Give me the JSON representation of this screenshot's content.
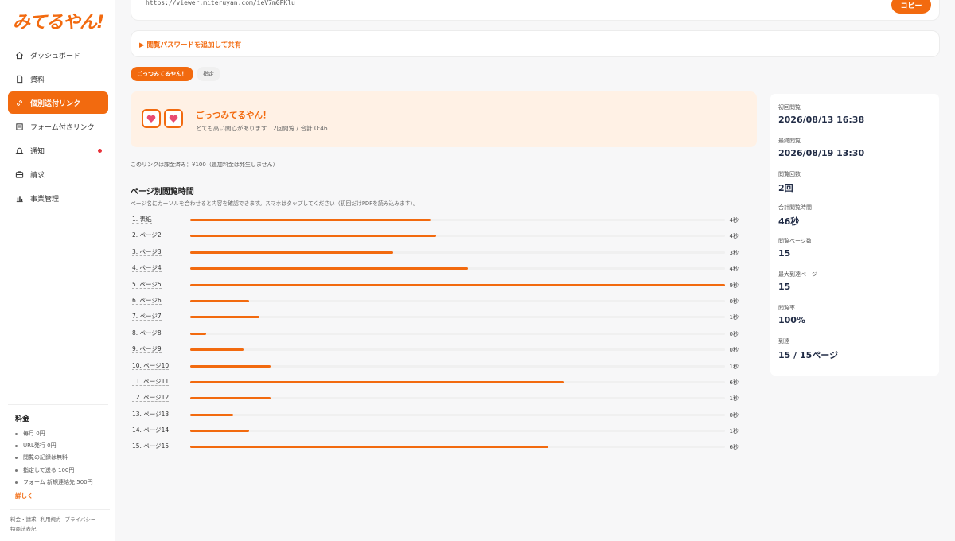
{
  "app": {
    "logo": "みてるやん!"
  },
  "sidebar": {
    "items": [
      {
        "label": "ダッシュボード",
        "icon": "home-icon",
        "active": false
      },
      {
        "label": "資料",
        "icon": "document-icon",
        "active": false
      },
      {
        "label": "個別送付リンク",
        "icon": "link-icon",
        "active": true
      },
      {
        "label": "フォーム付きリンク",
        "icon": "form-icon",
        "active": false
      },
      {
        "label": "通知",
        "icon": "bell-icon",
        "active": false,
        "badge_dot": true
      },
      {
        "label": "請求",
        "icon": "billing-icon",
        "active": false
      },
      {
        "label": "事業管理",
        "icon": "bar-chart-icon",
        "active": false
      }
    ],
    "pricing": {
      "title": "料金",
      "items": [
        "毎月 0円",
        "URL発行 0円",
        "閲覧の記録は無料",
        "指定して送る 100円",
        "フォーム 新規連絡先 500円"
      ],
      "link": "詳しく"
    },
    "footer_links": [
      "料金・請求",
      "利用規約",
      "プライバシー",
      "特商法表記"
    ]
  },
  "url_card": {
    "url": "https://viewer.miteruyan.com/ieV7mGPKlu",
    "copy_label": "コピー"
  },
  "password_toggle": {
    "label": "▶ 閲覧パスワードを追加して共有"
  },
  "tabs": [
    {
      "label": "ごっつみてるやん！",
      "active": true
    },
    {
      "label": "指定",
      "active": false
    }
  ],
  "verdict": {
    "title": "ごっつみてるやん！",
    "subtitle": "とても高い関心があります　2回閲覧 / 合計 0:46",
    "icon": "heart-eyes-icon"
  },
  "charge_note": "このリンクは課金済み：¥100（追加料金は発生しません）",
  "page_time": {
    "title": "ページ別閲覧時間",
    "description": "ページ名にカーソルを合わせると内容を確認できます。スマホはタップしてください（初回だけPDFを読み込みます）。",
    "rows": [
      {
        "label": "1. 表紙",
        "value": "4秒",
        "fraction": 0.45
      },
      {
        "label": "2. ページ2",
        "value": "4秒",
        "fraction": 0.46
      },
      {
        "label": "3. ページ3",
        "value": "3秒",
        "fraction": 0.38
      },
      {
        "label": "4. ページ4",
        "value": "4秒",
        "fraction": 0.52
      },
      {
        "label": "5. ページ5",
        "value": "9秒",
        "fraction": 1.0
      },
      {
        "label": "6. ページ6",
        "value": "0秒",
        "fraction": 0.11
      },
      {
        "label": "7. ページ7",
        "value": "1秒",
        "fraction": 0.13
      },
      {
        "label": "8. ページ8",
        "value": "0秒",
        "fraction": 0.03
      },
      {
        "label": "9. ページ9",
        "value": "0秒",
        "fraction": 0.1
      },
      {
        "label": "10. ページ10",
        "value": "1秒",
        "fraction": 0.15
      },
      {
        "label": "11. ページ11",
        "value": "6秒",
        "fraction": 0.7
      },
      {
        "label": "12. ページ12",
        "value": "1秒",
        "fraction": 0.15
      },
      {
        "label": "13. ページ13",
        "value": "0秒",
        "fraction": 0.08
      },
      {
        "label": "14. ページ14",
        "value": "1秒",
        "fraction": 0.11
      },
      {
        "label": "15. ページ15",
        "value": "6秒",
        "fraction": 0.67
      }
    ]
  },
  "stats": [
    {
      "label": "初回閲覧",
      "value": "2026/08/13 16:38"
    },
    {
      "label": "最終閲覧",
      "value": "2026/08/19 13:30"
    },
    {
      "label": "閲覧回数",
      "value": "2回"
    },
    {
      "label": "合計閲覧時間",
      "value": "46秒"
    },
    {
      "label": "閲覧ページ数",
      "value": "15"
    },
    {
      "label": "最大到達ページ",
      "value": "15"
    },
    {
      "label": "閲覧率",
      "value": "100%"
    },
    {
      "label": "到達",
      "value": "15 / 15ページ"
    }
  ],
  "colors": {
    "accent": "#f26a0f",
    "verdict_bg": "#fff1e5",
    "notification_dot": "#e8323a"
  }
}
